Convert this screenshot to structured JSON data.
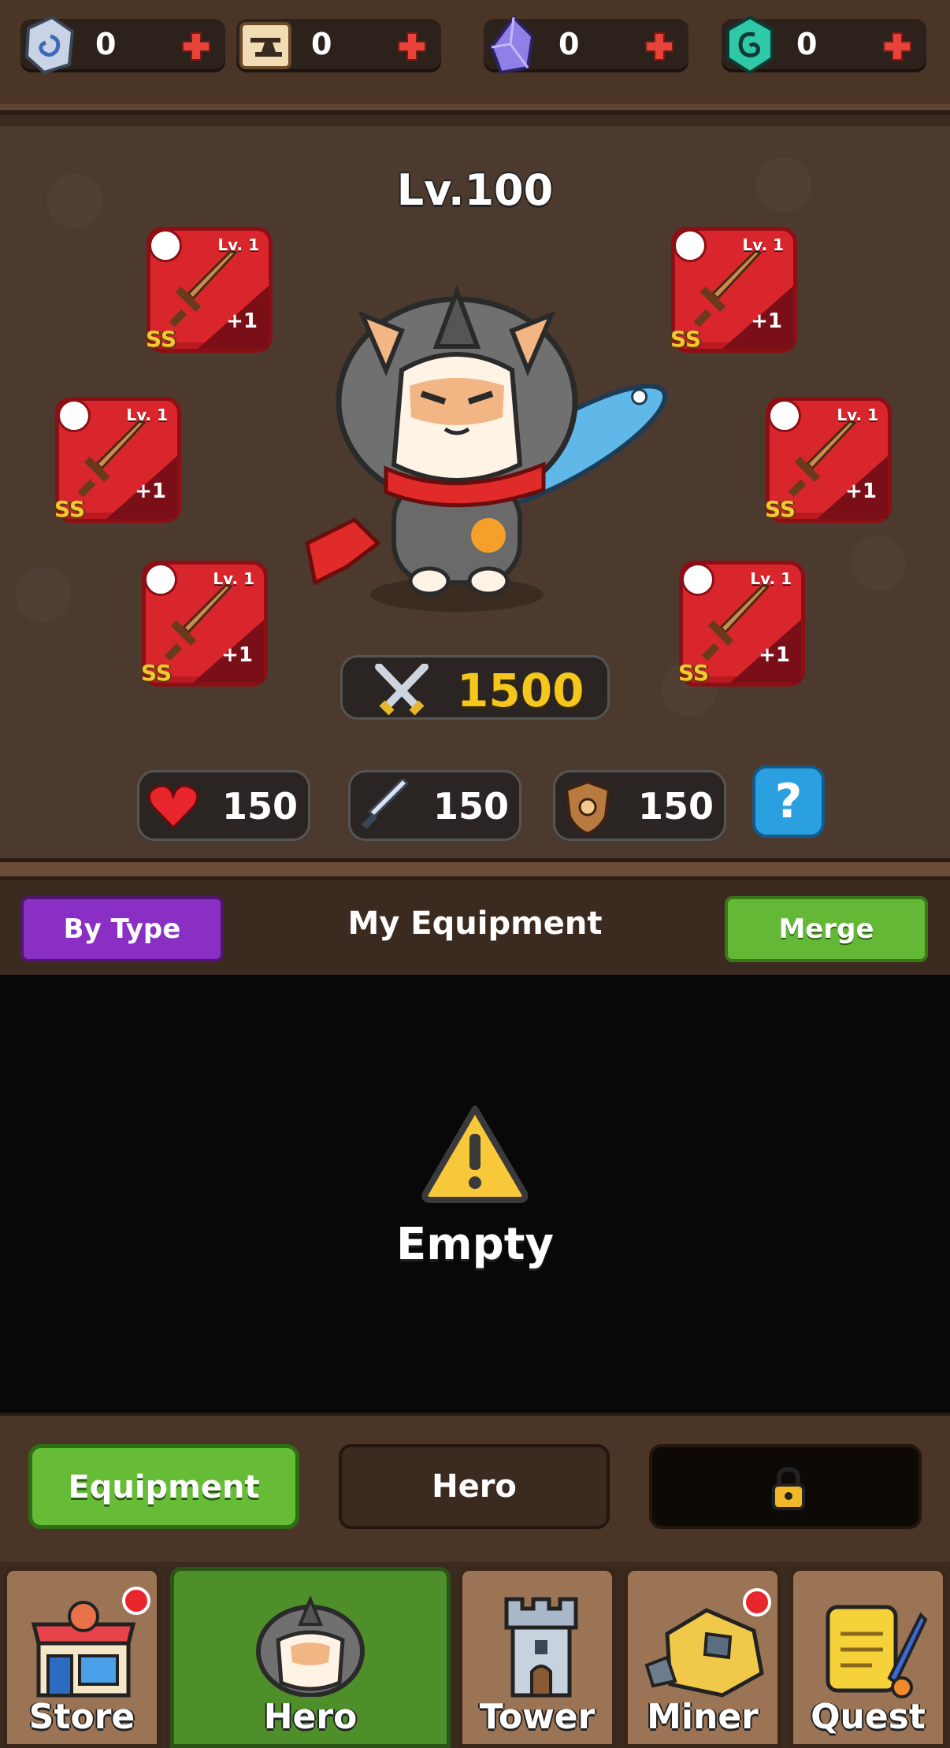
{
  "resources": [
    {
      "name": "rune-stone",
      "value": "0"
    },
    {
      "name": "anvil-scroll",
      "value": "0"
    },
    {
      "name": "crystal",
      "value": "0"
    },
    {
      "name": "emerald-rune",
      "value": "0"
    }
  ],
  "hero": {
    "level": "Lv.100",
    "power": "1500",
    "stats": {
      "health": "150",
      "attack": "150",
      "defense": "150"
    },
    "help_label": "?"
  },
  "equipment_slots": [
    {
      "grade": "SS",
      "level": "Lv. 1",
      "upgrade": "+1"
    },
    {
      "grade": "SS",
      "level": "Lv. 1",
      "upgrade": "+1"
    },
    {
      "grade": "SS",
      "level": "Lv. 1",
      "upgrade": "+1"
    },
    {
      "grade": "SS",
      "level": "Lv. 1",
      "upgrade": "+1"
    },
    {
      "grade": "SS",
      "level": "Lv. 1",
      "upgrade": "+1"
    },
    {
      "grade": "SS",
      "level": "Lv. 1",
      "upgrade": "+1"
    }
  ],
  "inventory": {
    "sort_label": "By Type",
    "title": "My Equipment",
    "merge_label": "Merge",
    "empty_text": "Empty"
  },
  "sub_tabs": {
    "equipment": "Equipment",
    "hero": "Hero"
  },
  "nav": {
    "store": "Store",
    "hero": "Hero",
    "tower": "Tower",
    "miner": "Miner",
    "quest": "Quest"
  },
  "colors": {
    "power": "#f5c61b",
    "slot": "#d8262c",
    "merge": "#63b836",
    "by_type": "#8a2fc3"
  }
}
